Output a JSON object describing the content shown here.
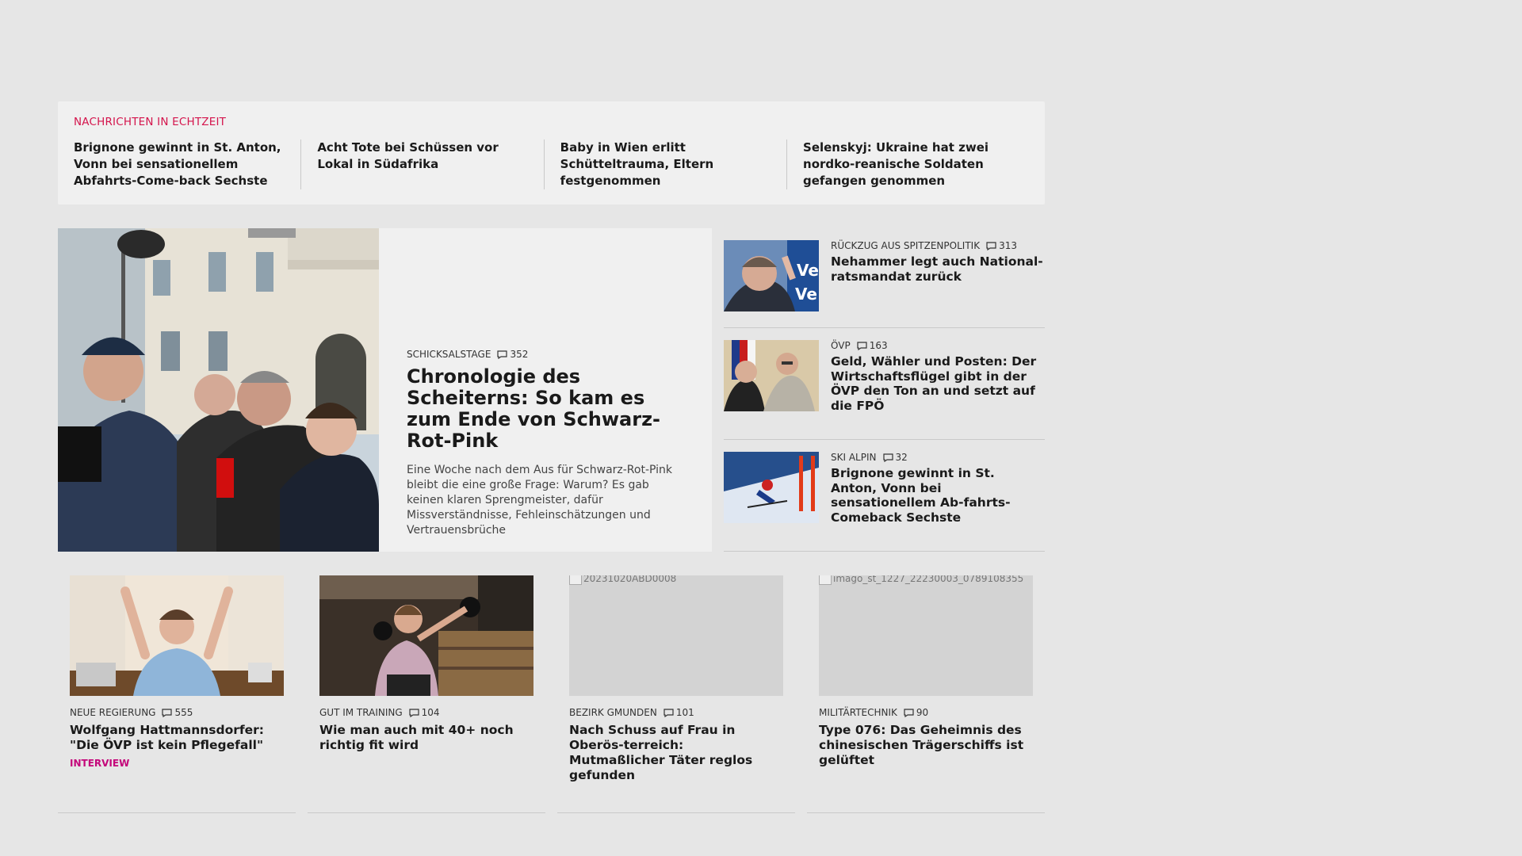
{
  "ticker": {
    "title": "NACHRICHTEN IN ECHTZEIT",
    "items": [
      "Brignone gewinnt in St. Anton, Vonn bei sensationellem Abfahrts-Come-back Sechste",
      "Acht Tote bei Schüssen vor Lokal in Südafrika",
      "Baby in Wien erlitt Schütteltrauma, Eltern festgenommen",
      "Selenskyj: Ukraine hat zwei nordko-reanische Soldaten gefangen genommen"
    ]
  },
  "lead": {
    "kicker": "SCHICKSALSTAGE",
    "comments": "352",
    "title": "Chronologie des Scheiterns: So kam es zum Ende von Schwarz-Rot-Pink",
    "teaser": "Eine Woche nach dem Aus für Schwarz-Rot-Pink bleibt die eine große Frage: Warum? Es gab keinen klaren Sprengmeister, dafür Missverständnisse, Fehleinschätzungen und Vertrauensbrüche"
  },
  "side": [
    {
      "kicker": "RÜCKZUG AUS SPITZENPOLITIK",
      "comments": "313",
      "title": "Nehammer legt auch National-ratsmandat zurück"
    },
    {
      "kicker": "ÖVP",
      "comments": "163",
      "title": "Geld, Wähler und Posten: Der Wirtschaftsflügel gibt in der ÖVP den Ton an und setzt auf die FPÖ"
    },
    {
      "kicker": "SKI ALPIN",
      "comments": "32",
      "title": "Brignone gewinnt in St. Anton, Vonn bei sensationellem Ab-fahrts-Comeback Sechste"
    }
  ],
  "cards": [
    {
      "kicker": "NEUE REGIERUNG",
      "comments": "555",
      "title": "Wolfgang Hattmannsdorfer: \"Die ÖVP ist kein Pflegefall\"",
      "tag": "INTERVIEW",
      "alt": ""
    },
    {
      "kicker": "GUT IM TRAINING",
      "comments": "104",
      "title": "Wie man auch mit 40+ noch richtig fit wird",
      "tag": "",
      "alt": ""
    },
    {
      "kicker": "BEZIRK GMUNDEN",
      "comments": "101",
      "title": "Nach Schuss auf Frau in Oberös-terreich: Mutmaßlicher Täter reglos gefunden",
      "tag": "",
      "alt": "20231020ABD0008"
    },
    {
      "kicker": "MILITÄRTECHNIK",
      "comments": "90",
      "title": "Type 076: Das Geheimnis des chinesischen Trägerschiffs ist gelüftet",
      "tag": "",
      "alt": "imago_st_1227_22230003_0789108355"
    }
  ]
}
